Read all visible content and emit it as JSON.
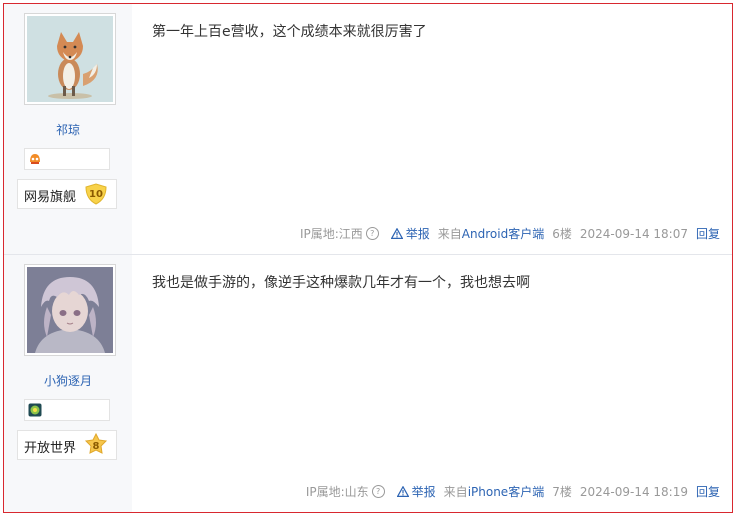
{
  "posts": [
    {
      "username": "祁琼",
      "level_name": "网易旗舰",
      "level_num": "10",
      "content": "第一年上百e营收，这个成绩本来就很厉害了",
      "ip_label": "IP属地:江西",
      "report": "举报",
      "from_prefix": "来自",
      "platform": "Android客户端",
      "floor": "6楼",
      "time": "2024-09-14 18:07",
      "reply": "回复",
      "avatar_icon": "fox-avatar",
      "badge_icon": "badge-icon"
    },
    {
      "username": "小狗逐月",
      "level_name": "开放世界",
      "level_num": "8",
      "content": "我也是做手游的，像逆手这种爆款几年才有一个，我也想去啊",
      "ip_label": "IP属地:山东",
      "report": "举报",
      "from_prefix": "来自",
      "platform": "iPhone客户端",
      "floor": "7楼",
      "time": "2024-09-14 18:19",
      "reply": "回复",
      "avatar_icon": "anime-avatar",
      "badge_icon": "badge-icon"
    }
  ],
  "colors": {
    "border": "#d8282f",
    "link": "#2d64b3",
    "meta": "#999999"
  }
}
